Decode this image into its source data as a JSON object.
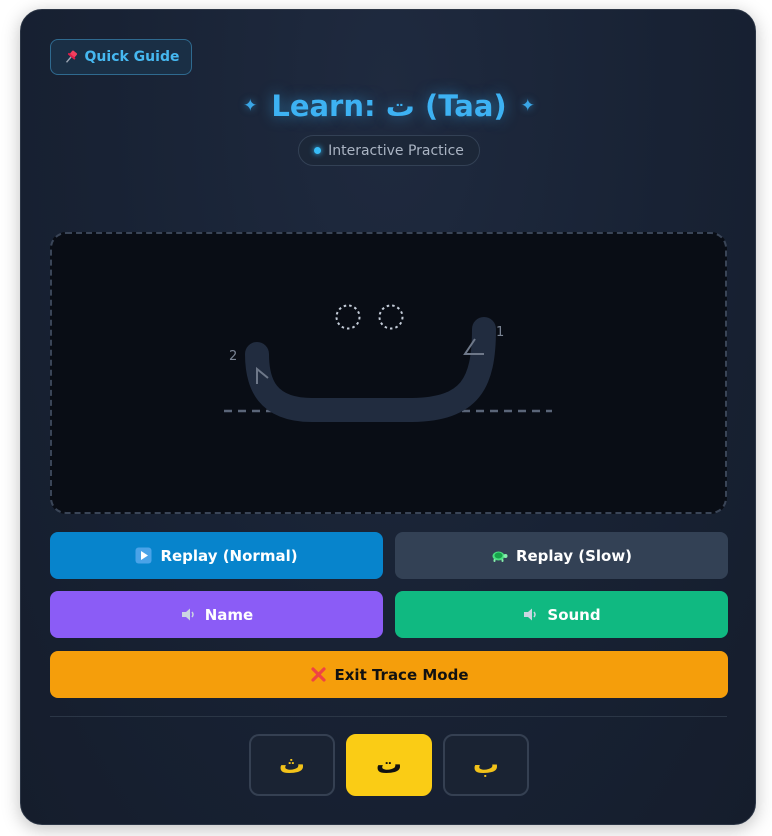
{
  "header": {
    "quick_guide_label": "Quick Guide",
    "title": "Learn: ت (Taa)",
    "mode_label": "Interactive Practice"
  },
  "trace": {
    "stroke_labels": [
      "1",
      "2"
    ]
  },
  "controls": {
    "replay_normal_label": "Replay (Normal)",
    "replay_slow_label": "Replay (Slow)",
    "name_label": "Name",
    "sound_label": "Sound",
    "exit_label": "Exit Trace Mode"
  },
  "letters": [
    {
      "char": "ث",
      "active": false
    },
    {
      "char": "ت",
      "active": true
    },
    {
      "char": "ب",
      "active": false
    }
  ],
  "colors": {
    "accent": "#38bdf8",
    "replay_normal": "#0784cc",
    "replay_slow": "#334155",
    "name": "#8b5cf6",
    "sound": "#10b981",
    "exit": "#f59e0b",
    "letter_active": "#facc15"
  }
}
